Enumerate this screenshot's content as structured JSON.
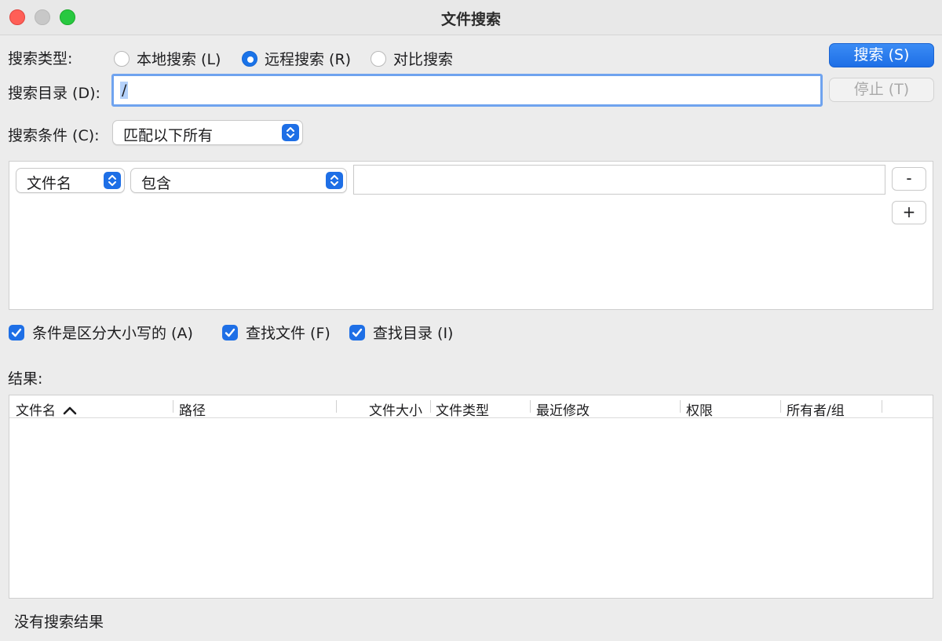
{
  "window": {
    "title": "文件搜索"
  },
  "search_type": {
    "label": "搜索类型:",
    "options": [
      {
        "label": "本地搜索 (L)",
        "selected": false
      },
      {
        "label": "远程搜索 (R)",
        "selected": true
      },
      {
        "label": "对比搜索",
        "selected": false
      }
    ]
  },
  "directory": {
    "label": "搜索目录 (D):",
    "value": "/"
  },
  "buttons": {
    "search": "搜索 (S)",
    "stop": "停止 (T)",
    "remove": "-",
    "add": "+"
  },
  "condition": {
    "label": "搜索条件 (C):",
    "selected": "匹配以下所有"
  },
  "criteria_row": {
    "field": "文件名",
    "operator": "包含",
    "value": ""
  },
  "options": [
    {
      "label": "条件是区分大小写的 (A)",
      "checked": true
    },
    {
      "label": "查找文件 (F)",
      "checked": true
    },
    {
      "label": "查找目录 (I)",
      "checked": true
    }
  ],
  "results": {
    "label": "结果:",
    "columns": [
      "文件名",
      "路径",
      "文件大小",
      "文件类型",
      "最近修改",
      "权限",
      "所有者/组"
    ],
    "sort_indicator": "chevron-up-icon",
    "rows": []
  },
  "status": "没有搜索结果",
  "colors": {
    "accent": "#1e6fe6",
    "focus_ring": "#6fa3ef",
    "close": "#ff5f57",
    "zoom": "#28c840"
  }
}
